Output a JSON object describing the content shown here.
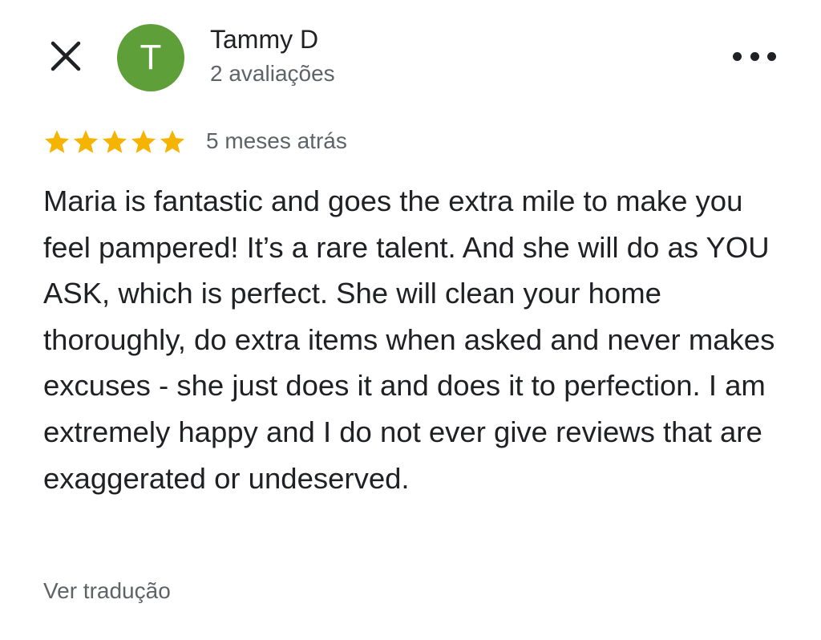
{
  "header": {
    "close_icon": "close-icon",
    "more_icon": "more-horiz-icon"
  },
  "author": {
    "avatar_letter": "T",
    "avatar_color": "#5e9f3a",
    "name": "Tammy D",
    "review_count": "2 avaliações"
  },
  "review": {
    "rating": 5,
    "max_rating": 5,
    "star_color": "#f5b400",
    "date": "5 meses atrás",
    "text": "Maria is fantastic and goes the extra mile to make you feel pampered! It’s a rare talent. And she will do as YOU ASK, which is perfect. She will clean your home thoroughly, do extra items when asked and never makes excuses - she just does it and does it to perfection. I am extremely happy and I do not ever give reviews that are exaggerated or undeserved.",
    "translate_label": "Ver tradução"
  }
}
